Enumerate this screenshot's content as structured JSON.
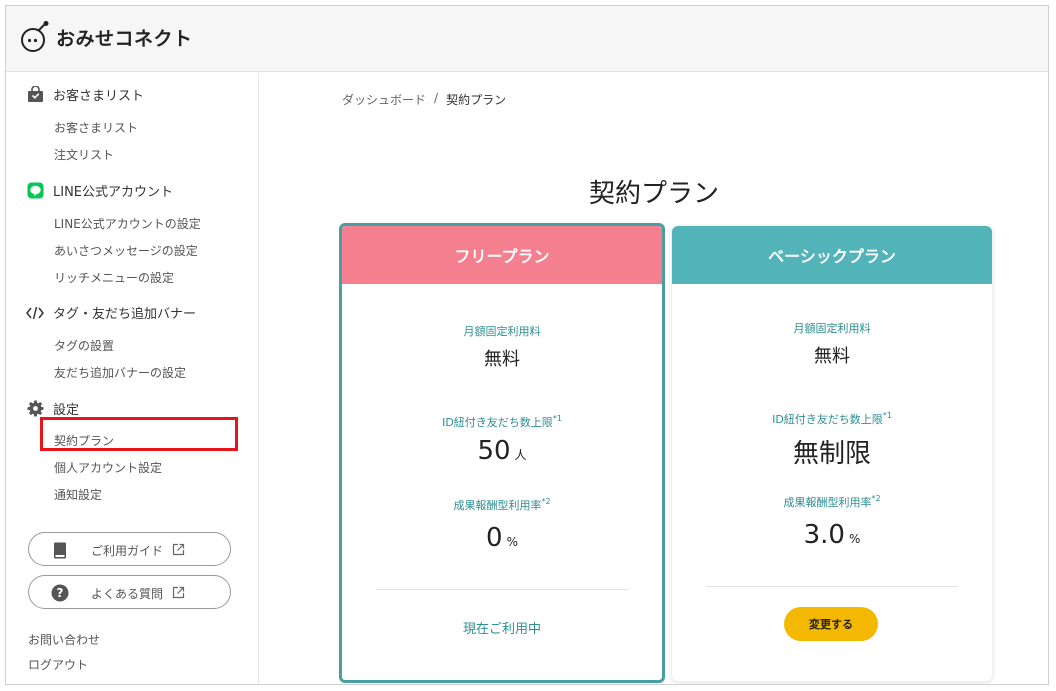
{
  "app": {
    "logo_text": "おみせコネクト"
  },
  "sidebar": {
    "sections": [
      {
        "title": "お客さまリスト",
        "icon": "shopping-bag-icon",
        "items": [
          "お客さまリスト",
          "注文リスト"
        ]
      },
      {
        "title": "LINE公式アカウント",
        "icon": "line-icon",
        "items": [
          "LINE公式アカウントの設定",
          "あいさつメッセージの設定",
          "リッチメニューの設定"
        ]
      },
      {
        "title": "タグ・友だち追加バナー",
        "icon": "code-icon",
        "items": [
          "タグの設置",
          "友だち追加バナーの設定"
        ]
      },
      {
        "title": "設定",
        "icon": "gear-icon",
        "items": [
          "契約プラン",
          "個人アカウント設定",
          "通知設定"
        ]
      }
    ],
    "guide_button": "ご利用ガイド",
    "faq_button": "よくある質問",
    "contact": "お問い合わせ",
    "logout": "ログアウト"
  },
  "breadcrumb": {
    "parent": "ダッシュボード",
    "separator": "/",
    "current": "契約プラン"
  },
  "main": {
    "title": "契約プラン"
  },
  "labels": {
    "monthly_fee": "月額固定利用料",
    "friend_limit": "ID紐付き友だち数上限",
    "friend_limit_note": "*1",
    "reward_rate": "成果報酬型利用率",
    "reward_rate_note": "*2"
  },
  "plans": {
    "free": {
      "name": "フリープラン",
      "fee": "無料",
      "limit": "50",
      "limit_unit": "人",
      "rate": "0",
      "rate_unit": "%",
      "status": "現在ご利用中"
    },
    "basic": {
      "name": "ベーシックプラン",
      "fee": "無料",
      "limit": "無制限",
      "rate": "3.0",
      "rate_unit": "%",
      "action": "変更する"
    }
  },
  "colors": {
    "free_header": "#f47f8f",
    "basic_header": "#52b3b8",
    "teal_text": "#2e8e93",
    "button_yellow": "#f5b800",
    "highlight_red": "#e8141c"
  }
}
